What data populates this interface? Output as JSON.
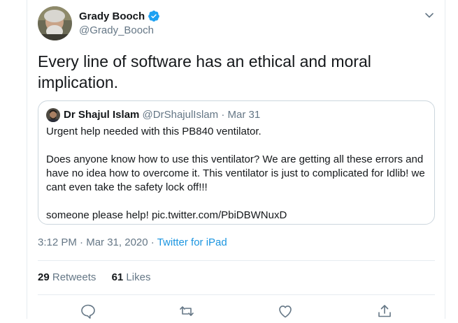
{
  "author": {
    "name": "Grady Booch",
    "handle": "@Grady_Booch",
    "verified": true
  },
  "tweet_text": "Every line of software has an ethical and moral implication.",
  "quoted_tweet": {
    "name": "Dr Shajul Islam",
    "handle": "@DrShajulIslam",
    "separator": "·",
    "date": "Mar 31",
    "paragraphs": [
      "Urgent help needed with this PB840 ventilator.",
      "Does anyone know how to use this ventilator? We are getting all these errors and have no idea how to overcome it. This ventilator is just to complicated for Idlib! we cant even take the safety lock off!!!",
      "someone please help! pic.twitter.com/PbiDBWNuxD"
    ]
  },
  "meta": {
    "time": "3:12 PM",
    "separator": "·",
    "date": "Mar 31, 2020",
    "source": "Twitter for iPad"
  },
  "stats": {
    "retweets_count": "29",
    "retweets_label": "Retweets",
    "likes_count": "61",
    "likes_label": "Likes"
  },
  "icons": {
    "reply": "reply-icon",
    "retweet": "retweet-icon",
    "like": "heart-icon",
    "share": "share-icon",
    "more": "chevron-down-icon",
    "verified": "verified-badge-icon"
  },
  "colors": {
    "text": "#14171a",
    "secondary": "#657786",
    "link": "#1b95e0",
    "border": "#ccd6dd",
    "verified": "#1da1f2"
  }
}
